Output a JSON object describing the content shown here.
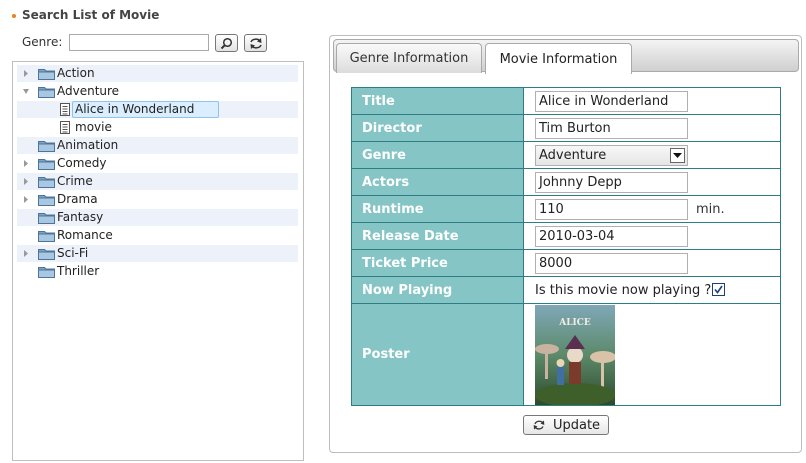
{
  "header": {
    "title": "Search List of Movie"
  },
  "search": {
    "label": "Genre:",
    "value": "",
    "search_icon": "magnifier-icon",
    "refresh_icon": "refresh-icon"
  },
  "tree": {
    "items": [
      {
        "label": "Action",
        "type": "folder",
        "expandable": true,
        "expanded": false
      },
      {
        "label": "Adventure",
        "type": "folder",
        "expandable": true,
        "expanded": true
      },
      {
        "label": "Alice in Wonderland",
        "type": "document",
        "selected": true
      },
      {
        "label": "movie",
        "type": "document"
      },
      {
        "label": "Animation",
        "type": "folder",
        "expandable": false
      },
      {
        "label": "Comedy",
        "type": "folder",
        "expandable": true
      },
      {
        "label": "Crime",
        "type": "folder",
        "expandable": true
      },
      {
        "label": "Drama",
        "type": "folder",
        "expandable": true
      },
      {
        "label": "Fantasy",
        "type": "folder",
        "expandable": false
      },
      {
        "label": "Romance",
        "type": "folder",
        "expandable": false
      },
      {
        "label": "Sci-Fi",
        "type": "folder",
        "expandable": true
      },
      {
        "label": "Thriller",
        "type": "folder",
        "expandable": false
      }
    ]
  },
  "tabs": [
    {
      "label": "Genre Information",
      "active": false
    },
    {
      "label": "Movie Information",
      "active": true
    }
  ],
  "form": {
    "title_label": "Title",
    "title_value": "Alice in Wonderland",
    "director_label": "Director",
    "director_value": "Tim Burton",
    "genre_label": "Genre",
    "genre_value": "Adventure",
    "actors_label": "Actors",
    "actors_value": "Johnny Depp",
    "runtime_label": "Runtime",
    "runtime_value": "110",
    "runtime_unit": "min.",
    "release_label": "Release Date",
    "release_value": "2010-03-04",
    "price_label": "Ticket Price",
    "price_value": "8000",
    "playing_label": "Now Playing",
    "playing_question": "Is this movie now playing ?",
    "playing_checked": true,
    "poster_label": "Poster"
  },
  "actions": {
    "update_label": "Update"
  },
  "colors": {
    "accent": "#e8821e",
    "label_bg": "#86c5c5",
    "table_border": "#2e7d82",
    "selection": "#dbeeff"
  }
}
